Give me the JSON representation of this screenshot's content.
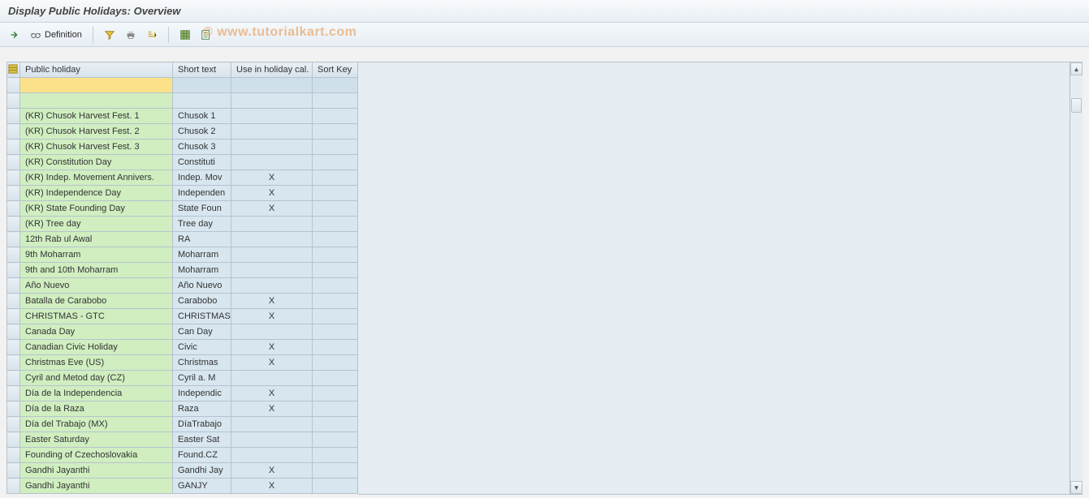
{
  "title": "Display Public Holidays: Overview",
  "toolbar": {
    "execute_tip": "Execute",
    "definition_label": "Definition",
    "filter_tip": "Filter",
    "print_tip": "Print",
    "sort_tip": "Sort",
    "selectall_tip": "Select All",
    "export_tip": "Export"
  },
  "watermark": "© www.tutorialkart.com",
  "columns": {
    "public_holiday": "Public holiday",
    "short_text": "Short text",
    "use_in_cal": "Use in holiday cal.",
    "sort_key": "Sort Key"
  },
  "rows": [
    {
      "sel": true,
      "ph": "",
      "st": "",
      "uc": "",
      "sk": ""
    },
    {
      "spacer": true,
      "ph": "",
      "st": "",
      "uc": "",
      "sk": ""
    },
    {
      "ph": "(KR) Chusok Harvest Fest. 1",
      "st": "Chusok 1",
      "uc": "",
      "sk": ""
    },
    {
      "ph": "(KR) Chusok Harvest Fest. 2",
      "st": "Chusok 2",
      "uc": "",
      "sk": ""
    },
    {
      "ph": "(KR) Chusok Harvest Fest. 3",
      "st": "Chusok 3",
      "uc": "",
      "sk": ""
    },
    {
      "ph": "(KR) Constitution Day",
      "st": "Constituti",
      "uc": "",
      "sk": ""
    },
    {
      "ph": "(KR) Indep. Movement Annivers.",
      "st": "Indep. Mov",
      "uc": "X",
      "sk": ""
    },
    {
      "ph": "(KR) Independence Day",
      "st": "Independen",
      "uc": "X",
      "sk": ""
    },
    {
      "ph": "(KR) State Founding Day",
      "st": "State Foun",
      "uc": "X",
      "sk": ""
    },
    {
      "ph": "(KR) Tree day",
      "st": "Tree day",
      "uc": "",
      "sk": ""
    },
    {
      "ph": "12th Rab ul Awal",
      "st": "RA",
      "uc": "",
      "sk": ""
    },
    {
      "ph": "9th Moharram",
      "st": "Moharram",
      "uc": "",
      "sk": ""
    },
    {
      "ph": "9th and 10th Moharram",
      "st": "Moharram",
      "uc": "",
      "sk": ""
    },
    {
      "ph": "Año Nuevo",
      "st": "Año Nuevo",
      "uc": "",
      "sk": ""
    },
    {
      "ph": "Batalla de Carabobo",
      "st": "Carabobo",
      "uc": "X",
      "sk": ""
    },
    {
      "ph": "CHRISTMAS - GTC",
      "st": "CHRISTMAS",
      "uc": "X",
      "sk": ""
    },
    {
      "ph": "Canada Day",
      "st": "Can Day",
      "uc": "",
      "sk": ""
    },
    {
      "ph": "Canadian Civic Holiday",
      "st": "Civic",
      "uc": "X",
      "sk": ""
    },
    {
      "ph": "Christmas Eve (US)",
      "st": "Christmas",
      "uc": "X",
      "sk": ""
    },
    {
      "ph": "Cyril and Metod day (CZ)",
      "st": "Cyril a. M",
      "uc": "",
      "sk": ""
    },
    {
      "ph": "Día de la Independencia",
      "st": "Independic",
      "uc": "X",
      "sk": ""
    },
    {
      "ph": "Día de la Raza",
      "st": "Raza",
      "uc": "X",
      "sk": ""
    },
    {
      "ph": "Día del Trabajo        (MX)",
      "st": "DíaTrabajo",
      "uc": "",
      "sk": ""
    },
    {
      "ph": "Easter Saturday",
      "st": "Easter Sat",
      "uc": "",
      "sk": ""
    },
    {
      "ph": "Founding of Czechoslovakia",
      "st": "Found.CZ",
      "uc": "",
      "sk": ""
    },
    {
      "ph": "Gandhi Jayanthi",
      "st": "Gandhi Jay",
      "uc": "X",
      "sk": ""
    },
    {
      "ph": "Gandhi Jayanthi",
      "st": "GANJY",
      "uc": "X",
      "sk": ""
    }
  ]
}
